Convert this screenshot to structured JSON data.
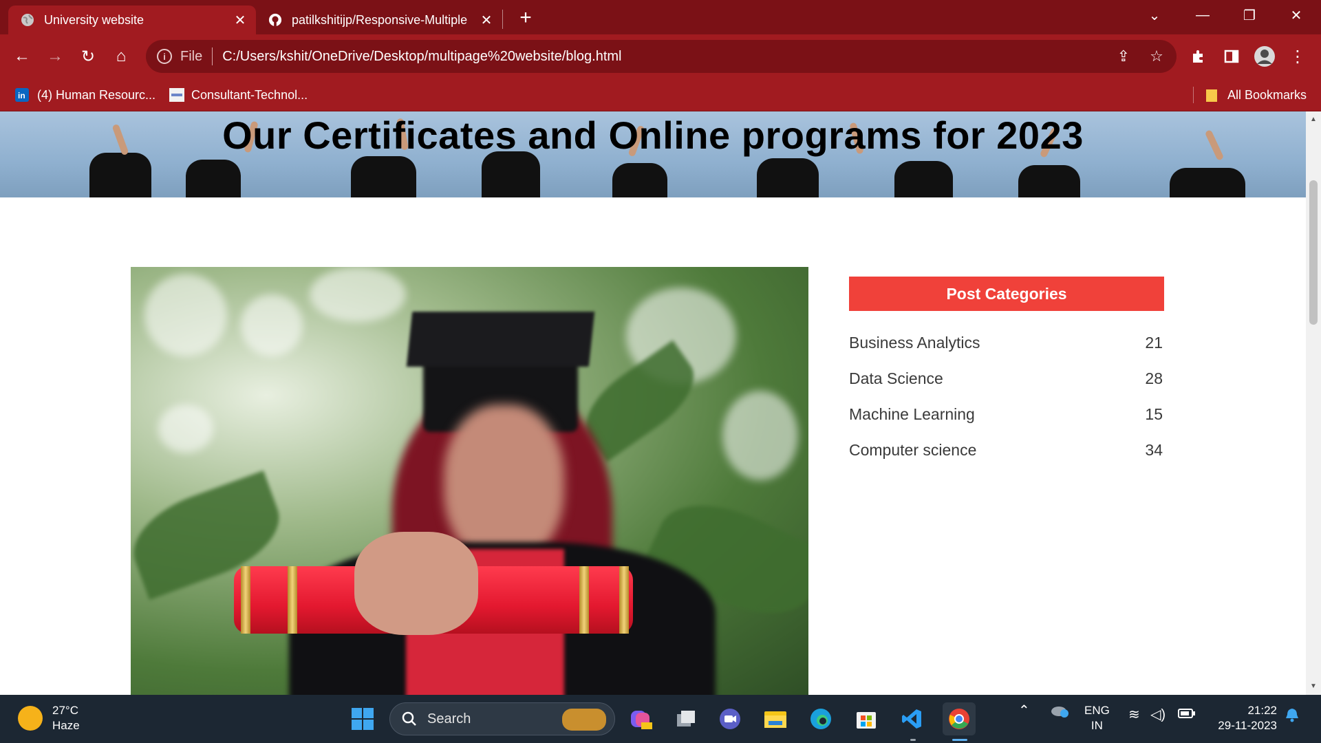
{
  "browser": {
    "tabs": [
      {
        "title": "University website",
        "active": true,
        "icon": "globe-icon"
      },
      {
        "title": "patilkshitijp/Responsive-Multiple",
        "active": false,
        "icon": "github-icon"
      }
    ],
    "address": {
      "scheme": "File",
      "url": "C:/Users/kshit/OneDrive/Desktop/multipage%20website/blog.html"
    },
    "bookmarks": [
      {
        "label": "(4) Human Resourc...",
        "icon": "linkedin-icon"
      },
      {
        "label": "Consultant-Technol...",
        "icon": "page-icon"
      }
    ],
    "all_bookmarks": "All Bookmarks",
    "theme_color": "#a11b20"
  },
  "page": {
    "hero_title": "Our Certificates and Online programs for 2023",
    "categories": {
      "heading": "Post Categories",
      "items": [
        {
          "name": "Business Analytics",
          "count": "21"
        },
        {
          "name": "Data Science",
          "count": "28"
        },
        {
          "name": "Machine Learning",
          "count": "15"
        },
        {
          "name": "Computer science",
          "count": "34"
        }
      ]
    },
    "accent_color": "#f0413a"
  },
  "taskbar": {
    "weather": {
      "temp": "27°C",
      "condition": "Haze"
    },
    "search_label": "Search",
    "language": {
      "lang": "ENG",
      "region": "IN"
    },
    "time": "21:22",
    "date": "29-11-2023"
  }
}
